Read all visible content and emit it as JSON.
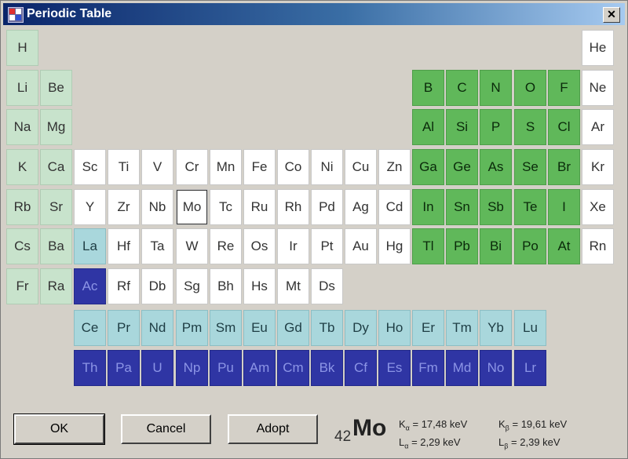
{
  "window": {
    "title": "Periodic Table",
    "close_symbol": "✕"
  },
  "colors": {
    "mint": "#c8e3cc",
    "green": "#60b85a",
    "white": "#ffffff",
    "lightblue": "#a9d7dc",
    "darkblue": "#2f35a4"
  },
  "selected_element": "Mo",
  "elements": [
    {
      "s": "H",
      "r": 0,
      "c": 0,
      "t": "mint"
    },
    {
      "s": "He",
      "r": 0,
      "c": 17,
      "t": "white"
    },
    {
      "s": "Li",
      "r": 1,
      "c": 0,
      "t": "mint"
    },
    {
      "s": "Be",
      "r": 1,
      "c": 1,
      "t": "mint"
    },
    {
      "s": "B",
      "r": 1,
      "c": 12,
      "t": "green"
    },
    {
      "s": "C",
      "r": 1,
      "c": 13,
      "t": "green"
    },
    {
      "s": "N",
      "r": 1,
      "c": 14,
      "t": "green"
    },
    {
      "s": "O",
      "r": 1,
      "c": 15,
      "t": "green"
    },
    {
      "s": "F",
      "r": 1,
      "c": 16,
      "t": "green"
    },
    {
      "s": "Ne",
      "r": 1,
      "c": 17,
      "t": "white"
    },
    {
      "s": "Na",
      "r": 2,
      "c": 0,
      "t": "mint"
    },
    {
      "s": "Mg",
      "r": 2,
      "c": 1,
      "t": "mint"
    },
    {
      "s": "Al",
      "r": 2,
      "c": 12,
      "t": "green"
    },
    {
      "s": "Si",
      "r": 2,
      "c": 13,
      "t": "green"
    },
    {
      "s": "P",
      "r": 2,
      "c": 14,
      "t": "green"
    },
    {
      "s": "S",
      "r": 2,
      "c": 15,
      "t": "green"
    },
    {
      "s": "Cl",
      "r": 2,
      "c": 16,
      "t": "green"
    },
    {
      "s": "Ar",
      "r": 2,
      "c": 17,
      "t": "white"
    },
    {
      "s": "K",
      "r": 3,
      "c": 0,
      "t": "mint"
    },
    {
      "s": "Ca",
      "r": 3,
      "c": 1,
      "t": "mint"
    },
    {
      "s": "Sc",
      "r": 3,
      "c": 2,
      "t": "white"
    },
    {
      "s": "Ti",
      "r": 3,
      "c": 3,
      "t": "white"
    },
    {
      "s": "V",
      "r": 3,
      "c": 4,
      "t": "white"
    },
    {
      "s": "Cr",
      "r": 3,
      "c": 5,
      "t": "white"
    },
    {
      "s": "Mn",
      "r": 3,
      "c": 6,
      "t": "white"
    },
    {
      "s": "Fe",
      "r": 3,
      "c": 7,
      "t": "white"
    },
    {
      "s": "Co",
      "r": 3,
      "c": 8,
      "t": "white"
    },
    {
      "s": "Ni",
      "r": 3,
      "c": 9,
      "t": "white"
    },
    {
      "s": "Cu",
      "r": 3,
      "c": 10,
      "t": "white"
    },
    {
      "s": "Zn",
      "r": 3,
      "c": 11,
      "t": "white"
    },
    {
      "s": "Ga",
      "r": 3,
      "c": 12,
      "t": "green"
    },
    {
      "s": "Ge",
      "r": 3,
      "c": 13,
      "t": "green"
    },
    {
      "s": "As",
      "r": 3,
      "c": 14,
      "t": "green"
    },
    {
      "s": "Se",
      "r": 3,
      "c": 15,
      "t": "green"
    },
    {
      "s": "Br",
      "r": 3,
      "c": 16,
      "t": "green"
    },
    {
      "s": "Kr",
      "r": 3,
      "c": 17,
      "t": "white"
    },
    {
      "s": "Rb",
      "r": 4,
      "c": 0,
      "t": "mint"
    },
    {
      "s": "Sr",
      "r": 4,
      "c": 1,
      "t": "mint"
    },
    {
      "s": "Y",
      "r": 4,
      "c": 2,
      "t": "white"
    },
    {
      "s": "Zr",
      "r": 4,
      "c": 3,
      "t": "white"
    },
    {
      "s": "Nb",
      "r": 4,
      "c": 4,
      "t": "white"
    },
    {
      "s": "Mo",
      "r": 4,
      "c": 5,
      "t": "white"
    },
    {
      "s": "Tc",
      "r": 4,
      "c": 6,
      "t": "white"
    },
    {
      "s": "Ru",
      "r": 4,
      "c": 7,
      "t": "white"
    },
    {
      "s": "Rh",
      "r": 4,
      "c": 8,
      "t": "white"
    },
    {
      "s": "Pd",
      "r": 4,
      "c": 9,
      "t": "white"
    },
    {
      "s": "Ag",
      "r": 4,
      "c": 10,
      "t": "white"
    },
    {
      "s": "Cd",
      "r": 4,
      "c": 11,
      "t": "white"
    },
    {
      "s": "In",
      "r": 4,
      "c": 12,
      "t": "green"
    },
    {
      "s": "Sn",
      "r": 4,
      "c": 13,
      "t": "green"
    },
    {
      "s": "Sb",
      "r": 4,
      "c": 14,
      "t": "green"
    },
    {
      "s": "Te",
      "r": 4,
      "c": 15,
      "t": "green"
    },
    {
      "s": "I",
      "r": 4,
      "c": 16,
      "t": "green"
    },
    {
      "s": "Xe",
      "r": 4,
      "c": 17,
      "t": "white"
    },
    {
      "s": "Cs",
      "r": 5,
      "c": 0,
      "t": "mint"
    },
    {
      "s": "Ba",
      "r": 5,
      "c": 1,
      "t": "mint"
    },
    {
      "s": "La",
      "r": 5,
      "c": 2,
      "t": "lightblue"
    },
    {
      "s": "Hf",
      "r": 5,
      "c": 3,
      "t": "white"
    },
    {
      "s": "Ta",
      "r": 5,
      "c": 4,
      "t": "white"
    },
    {
      "s": "W",
      "r": 5,
      "c": 5,
      "t": "white"
    },
    {
      "s": "Re",
      "r": 5,
      "c": 6,
      "t": "white"
    },
    {
      "s": "Os",
      "r": 5,
      "c": 7,
      "t": "white"
    },
    {
      "s": "Ir",
      "r": 5,
      "c": 8,
      "t": "white"
    },
    {
      "s": "Pt",
      "r": 5,
      "c": 9,
      "t": "white"
    },
    {
      "s": "Au",
      "r": 5,
      "c": 10,
      "t": "white"
    },
    {
      "s": "Hg",
      "r": 5,
      "c": 11,
      "t": "white"
    },
    {
      "s": "Tl",
      "r": 5,
      "c": 12,
      "t": "green"
    },
    {
      "s": "Pb",
      "r": 5,
      "c": 13,
      "t": "green"
    },
    {
      "s": "Bi",
      "r": 5,
      "c": 14,
      "t": "green"
    },
    {
      "s": "Po",
      "r": 5,
      "c": 15,
      "t": "green"
    },
    {
      "s": "At",
      "r": 5,
      "c": 16,
      "t": "green"
    },
    {
      "s": "Rn",
      "r": 5,
      "c": 17,
      "t": "white"
    },
    {
      "s": "Fr",
      "r": 6,
      "c": 0,
      "t": "mint"
    },
    {
      "s": "Ra",
      "r": 6,
      "c": 1,
      "t": "mint"
    },
    {
      "s": "Ac",
      "r": 6,
      "c": 2,
      "t": "darkblue"
    },
    {
      "s": "Rf",
      "r": 6,
      "c": 3,
      "t": "white"
    },
    {
      "s": "Db",
      "r": 6,
      "c": 4,
      "t": "white"
    },
    {
      "s": "Sg",
      "r": 6,
      "c": 5,
      "t": "white"
    },
    {
      "s": "Bh",
      "r": 6,
      "c": 6,
      "t": "white"
    },
    {
      "s": "Hs",
      "r": 6,
      "c": 7,
      "t": "white"
    },
    {
      "s": "Mt",
      "r": 6,
      "c": 8,
      "t": "white"
    },
    {
      "s": "Ds",
      "r": 6,
      "c": 9,
      "t": "white"
    },
    {
      "s": "Ce",
      "r": 7,
      "c": 2,
      "t": "lightblue"
    },
    {
      "s": "Pr",
      "r": 7,
      "c": 3,
      "t": "lightblue"
    },
    {
      "s": "Nd",
      "r": 7,
      "c": 4,
      "t": "lightblue"
    },
    {
      "s": "Pm",
      "r": 7,
      "c": 5,
      "t": "lightblue"
    },
    {
      "s": "Sm",
      "r": 7,
      "c": 6,
      "t": "lightblue"
    },
    {
      "s": "Eu",
      "r": 7,
      "c": 7,
      "t": "lightblue"
    },
    {
      "s": "Gd",
      "r": 7,
      "c": 8,
      "t": "lightblue"
    },
    {
      "s": "Tb",
      "r": 7,
      "c": 9,
      "t": "lightblue"
    },
    {
      "s": "Dy",
      "r": 7,
      "c": 10,
      "t": "lightblue"
    },
    {
      "s": "Ho",
      "r": 7,
      "c": 11,
      "t": "lightblue"
    },
    {
      "s": "Er",
      "r": 7,
      "c": 12,
      "t": "lightblue"
    },
    {
      "s": "Tm",
      "r": 7,
      "c": 13,
      "t": "lightblue"
    },
    {
      "s": "Yb",
      "r": 7,
      "c": 14,
      "t": "lightblue"
    },
    {
      "s": "Lu",
      "r": 7,
      "c": 15,
      "t": "lightblue"
    },
    {
      "s": "Th",
      "r": 8,
      "c": 2,
      "t": "darkblue"
    },
    {
      "s": "Pa",
      "r": 8,
      "c": 3,
      "t": "darkblue"
    },
    {
      "s": "U",
      "r": 8,
      "c": 4,
      "t": "darkblue"
    },
    {
      "s": "Np",
      "r": 8,
      "c": 5,
      "t": "darkblue"
    },
    {
      "s": "Pu",
      "r": 8,
      "c": 6,
      "t": "darkblue"
    },
    {
      "s": "Am",
      "r": 8,
      "c": 7,
      "t": "darkblue"
    },
    {
      "s": "Cm",
      "r": 8,
      "c": 8,
      "t": "darkblue"
    },
    {
      "s": "Bk",
      "r": 8,
      "c": 9,
      "t": "darkblue"
    },
    {
      "s": "Cf",
      "r": 8,
      "c": 10,
      "t": "darkblue"
    },
    {
      "s": "Es",
      "r": 8,
      "c": 11,
      "t": "darkblue"
    },
    {
      "s": "Fm",
      "r": 8,
      "c": 12,
      "t": "darkblue"
    },
    {
      "s": "Md",
      "r": 8,
      "c": 13,
      "t": "darkblue"
    },
    {
      "s": "No",
      "r": 8,
      "c": 14,
      "t": "darkblue"
    },
    {
      "s": "Lr",
      "r": 8,
      "c": 15,
      "t": "darkblue"
    }
  ],
  "buttons": {
    "ok": "OK",
    "cancel": "Cancel",
    "adopt": "Adopt"
  },
  "info": {
    "atomic_number": "42",
    "symbol": "Mo",
    "ka": {
      "label": "K",
      "sub": "α",
      "value": "= 17,48 keV"
    },
    "kb": {
      "label": "K",
      "sub": "β",
      "value": "= 19,61 keV"
    },
    "la": {
      "label": "L",
      "sub": "α",
      "value": "= 2,29 keV"
    },
    "lb": {
      "label": "L",
      "sub": "β",
      "value": "= 2,39 keV"
    }
  }
}
